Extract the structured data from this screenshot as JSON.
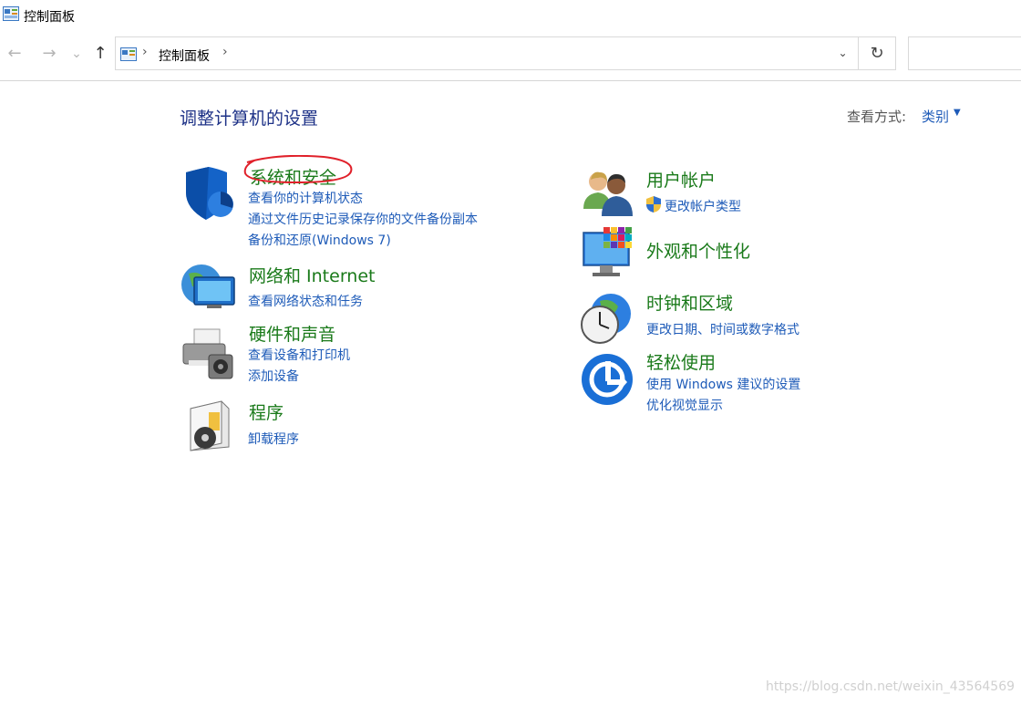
{
  "window": {
    "title": "控制面板"
  },
  "nav": {
    "back_icon": "←",
    "forward_icon": "→",
    "recent_icon": "⌄",
    "up_icon": "↑",
    "breadcrumb": "控制面板",
    "sep": "›",
    "dropdown_icon": "⌄",
    "refresh_icon": "↻"
  },
  "page": {
    "title": "调整计算机的设置",
    "view_by_label": "查看方式:",
    "view_by_value": "类别",
    "caret": "▼"
  },
  "categories": {
    "system_security": {
      "title": "系统和安全",
      "links": [
        "查看你的计算机状态",
        "通过文件历史记录保存你的文件备份副本",
        "备份和还原(Windows 7)"
      ]
    },
    "network": {
      "title": "网络和 Internet",
      "links": [
        "查看网络状态和任务"
      ]
    },
    "hardware": {
      "title": "硬件和声音",
      "links": [
        "查看设备和打印机",
        "添加设备"
      ]
    },
    "programs": {
      "title": "程序",
      "links": [
        "卸载程序"
      ]
    },
    "user_accounts": {
      "title": "用户帐户",
      "links": [
        "更改帐户类型"
      ]
    },
    "appearance": {
      "title": "外观和个性化"
    },
    "clock_region": {
      "title": "时钟和区域",
      "links": [
        "更改日期、时间或数字格式"
      ]
    },
    "ease_access": {
      "title": "轻松使用",
      "links": [
        "使用 Windows 建议的设置",
        "优化视觉显示"
      ]
    }
  },
  "colors": {
    "category_title": "#1a7a1a",
    "link": "#1e5bb8",
    "heading": "#1e3287",
    "annotation": "#e0202a"
  },
  "watermark": "https://blog.csdn.net/weixin_43564569"
}
